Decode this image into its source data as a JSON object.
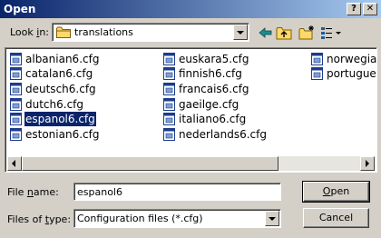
{
  "window": {
    "title": "Open",
    "help_glyph": "?",
    "close_glyph": "✕"
  },
  "lookin": {
    "label_pre": "Look ",
    "label_accel": "i",
    "label_post": "n:",
    "value": "translations"
  },
  "toolbar": {
    "icons": [
      "back-arrow-icon",
      "up-one-level-icon",
      "new-folder-icon",
      "view-menu-icon"
    ]
  },
  "files": {
    "col1": [
      "albanian6.cfg",
      "catalan6.cfg",
      "deutsch6.cfg",
      "dutch6.cfg",
      "espanol6.cfg",
      "estonian6.cfg"
    ],
    "col2": [
      "euskara5.cfg",
      "finnish6.cfg",
      "francais6.cfg",
      "gaeilge.cfg",
      "italiano6.cfg",
      "nederlands6.cfg"
    ],
    "col3": [
      "norwegia",
      "portugue"
    ],
    "selected": "espanol6.cfg"
  },
  "filename": {
    "label_pre": "File ",
    "label_accel": "n",
    "label_post": "ame:",
    "value": "espanol6"
  },
  "filetype": {
    "label_pre": "Files of ",
    "label_accel": "t",
    "label_post": "ype:",
    "value": "Configuration files (*.cfg)"
  },
  "buttons": {
    "open_accel": "O",
    "open_rest": "pen",
    "cancel": "Cancel"
  },
  "colors": {
    "titlebar_start": "#0a246a",
    "titlebar_end": "#a6caf0",
    "selection": "#0a246a",
    "face": "#d4d0c8"
  }
}
